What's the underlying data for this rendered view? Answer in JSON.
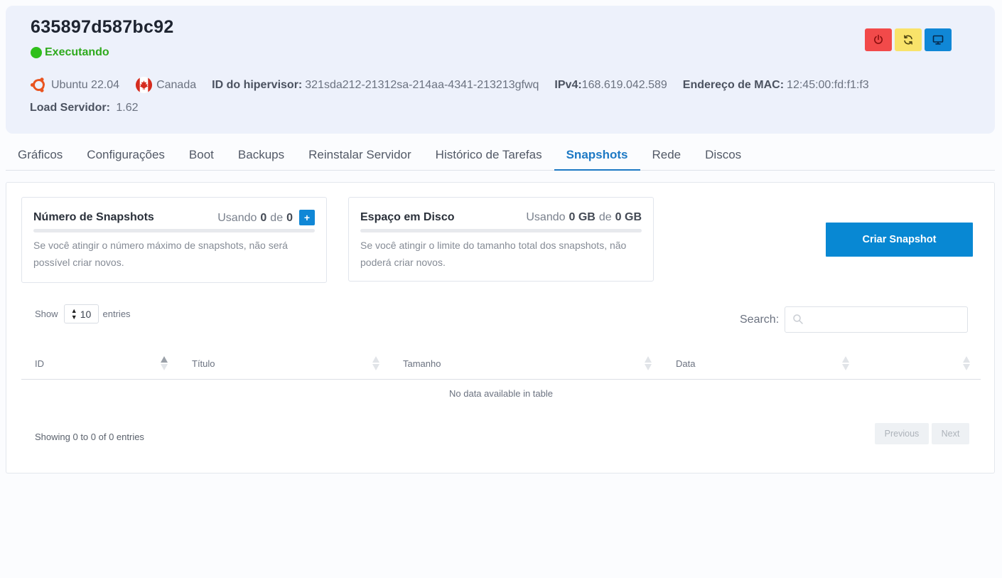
{
  "server": {
    "name": "635897d587bc92",
    "status": "Executando",
    "os": "Ubuntu 22.04",
    "location": "Canada",
    "hypervisor_label": "ID do hipervisor:",
    "hypervisor_value": "321sda212-21312sa-214aa-4341-213213gfwq",
    "ipv4_label": "IPv4:",
    "ipv4_value": "168.619.042.589",
    "mac_label": "Endereço de MAC:",
    "mac_value": "12:45:00:fd:f1:f3",
    "load_label": "Load Servidor:",
    "load_value": "1.62"
  },
  "actions": [
    {
      "name": "power",
      "icon": "power-icon",
      "color": "#f24a4a"
    },
    {
      "name": "restart",
      "icon": "refresh-icon",
      "color": "#f9e36a"
    },
    {
      "name": "console",
      "icon": "monitor-icon",
      "color": "#1087d6"
    }
  ],
  "tabs": [
    {
      "label": "Gráficos"
    },
    {
      "label": "Configurações"
    },
    {
      "label": "Boot"
    },
    {
      "label": "Backups"
    },
    {
      "label": "Reinstalar Servidor"
    },
    {
      "label": "Histórico de Tarefas"
    },
    {
      "label": "Snapshots",
      "active": true
    },
    {
      "label": "Rede"
    },
    {
      "label": "Discos"
    }
  ],
  "quota_snapshots": {
    "title": "Número de Snapshots",
    "using_label": "Usando",
    "used": "0",
    "of_label": "de",
    "limit": "0",
    "add_label": "+",
    "usage_fraction": 0,
    "description": "Se você atingir o número máximo de snapshots, não será possível criar novos."
  },
  "quota_disk": {
    "title": "Espaço em Disco",
    "using_label": "Usando",
    "used": "0 GB",
    "of_label": "de",
    "limit": "0 GB",
    "usage_fraction": 0,
    "description": "Se você atingir o limite do tamanho total dos snapshots, não poderá criar novos."
  },
  "create_button": "Criar Snapshot",
  "table": {
    "show_label": "Show",
    "page_length": "10",
    "entries_label": "entries",
    "search_label": "Search:",
    "search_value": "",
    "columns": [
      "ID",
      "Título",
      "Tamanho",
      "Data"
    ],
    "empty_text": "No data available in table",
    "info": "Showing 0 to 0 of 0 entries",
    "previous_label": "Previous",
    "next_label": "Next"
  },
  "colors": {
    "accent": "#1d79c4",
    "primary_button": "#0888d3",
    "status_green": "#2faa1d",
    "header_bg": "#edf1fb"
  }
}
